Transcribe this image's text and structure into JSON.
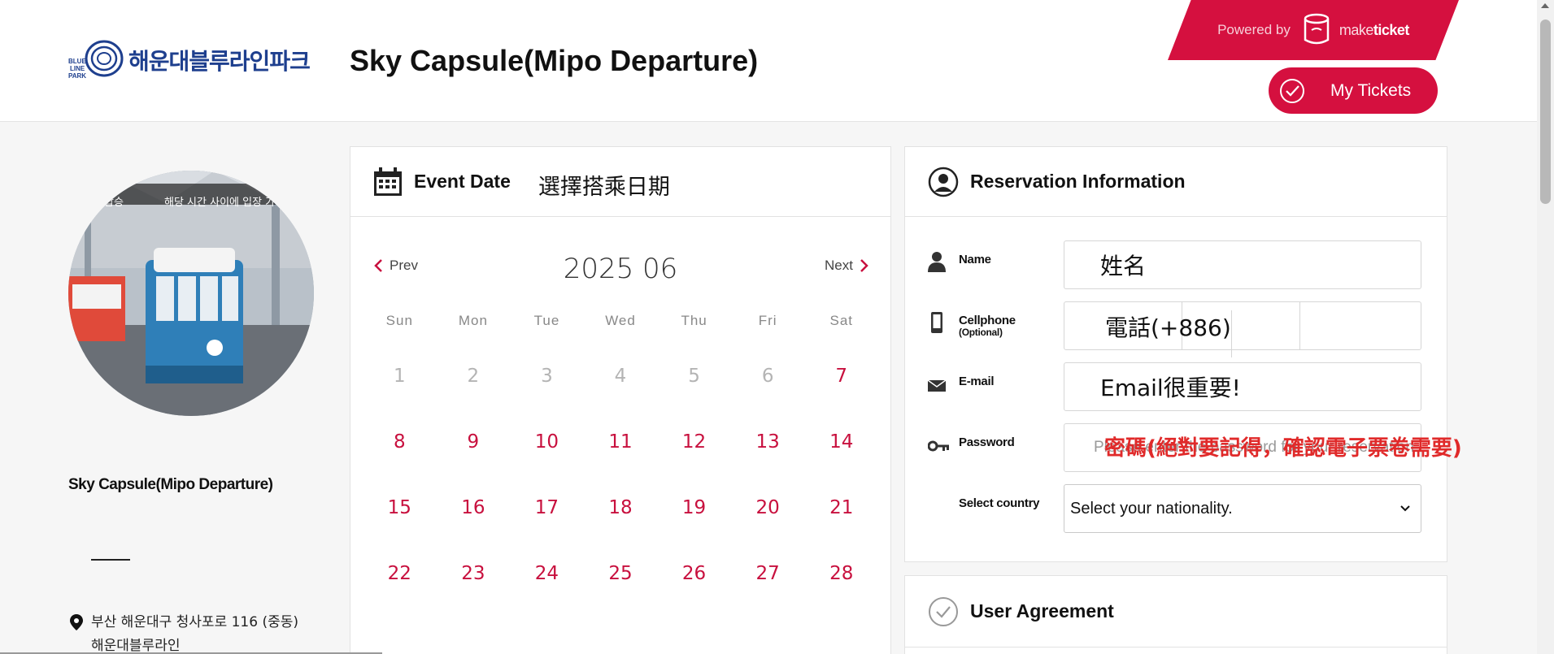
{
  "header": {
    "logo_text": "해운대블루라인파크",
    "logo_mark_text": "BLUE LINE PARK",
    "page_title": "Sky Capsule(Mipo Departure)",
    "powered_by": "Powered by",
    "brand_light": "make",
    "brand_bold": "ticket",
    "my_tickets_label": "My Tickets",
    "accent_color": "#d5103f"
  },
  "left": {
    "photo_caption": "해당 시간 사이에 입장 가",
    "photo_caption_left": "탑승",
    "title": "Sky Capsule(Mipo Departure)",
    "address_line1": "부산 해운대구 청사포로 116 (중동)",
    "address_line2": "해운대블루라인"
  },
  "calendar": {
    "title": "Event Date",
    "annotation": "選擇搭乘日期",
    "prev_label": "Prev",
    "next_label": "Next",
    "month_label": "2025 06",
    "weekdays": [
      "Sun",
      "Mon",
      "Tue",
      "Wed",
      "Thu",
      "Fri",
      "Sat"
    ],
    "days": [
      "1",
      "2",
      "3",
      "4",
      "5",
      "6",
      "7",
      "8",
      "9",
      "10",
      "11",
      "12",
      "13",
      "14",
      "15",
      "16",
      "17",
      "18",
      "19",
      "20",
      "21",
      "22",
      "23",
      "24",
      "25",
      "26",
      "27",
      "28"
    ],
    "past_days_count": 6,
    "available_color": "#c8103e",
    "past_color": "#b4b4b4"
  },
  "reservation": {
    "title": "Reservation Information",
    "name_label": "Name",
    "name_value": "姓名",
    "cellphone_label": "Cellphone",
    "cellphone_note": "(Optional)",
    "cellphone_annotation": "電話(+886)",
    "email_label": "E-mail",
    "email_value": "Email很重要!",
    "password_label": "Password",
    "password_placeholder": "Please enter the password for your reservation",
    "password_annotation": "密碼(絕對要記得，確認電子票卷需要)",
    "country_label": "Select country",
    "country_value": "Select your nationality."
  },
  "agreement": {
    "title": "User Agreement"
  }
}
